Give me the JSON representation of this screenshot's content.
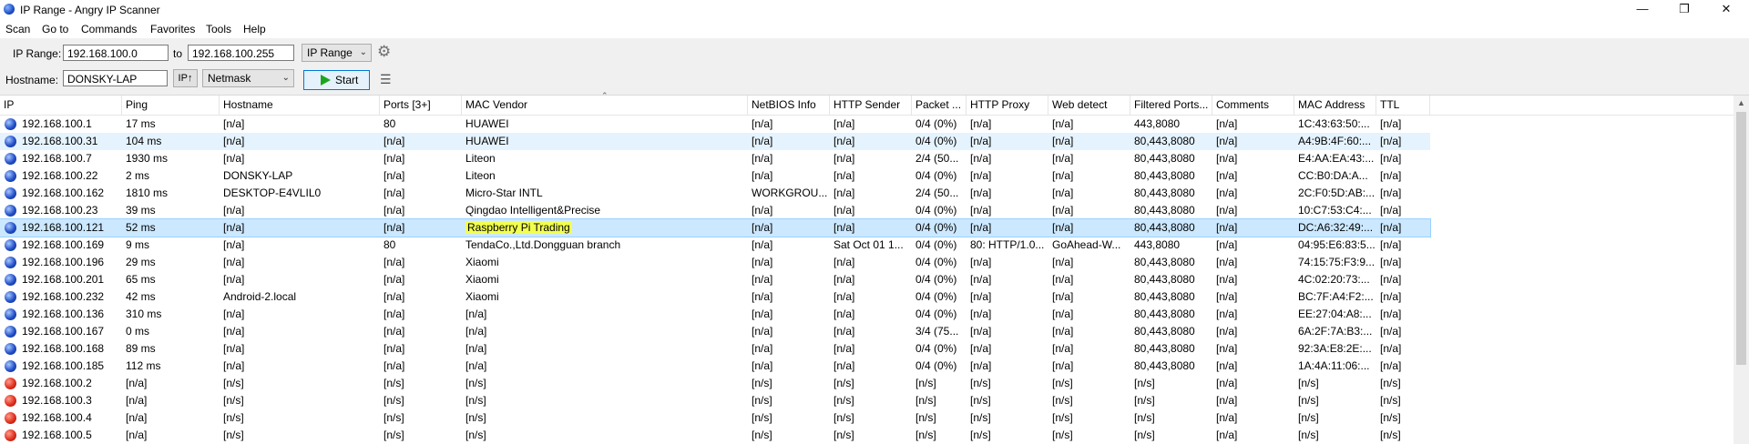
{
  "window": {
    "title": "IP Range - Angry IP Scanner",
    "controls": {
      "minimize": "—",
      "maximize": "❐",
      "close": "✕"
    }
  },
  "menu": [
    "Scan",
    "Go to",
    "Commands",
    "Favorites",
    "Tools",
    "Help"
  ],
  "toolbar": {
    "ip_range_label": "IP Range:",
    "range_start": "192.168.100.0",
    "to_label": "to",
    "range_end": "192.168.100.255",
    "feeder_select": "IP Range",
    "hostname_label": "Hostname:",
    "hostname_value": "DONSKY-LAP",
    "ip_up_button": "IP↑",
    "netmask_select": "Netmask",
    "start_button": "Start",
    "icons": [
      "gear-icon",
      "columns-list-icon",
      "start-play-icon"
    ]
  },
  "colors": {
    "accent": "#0078d7",
    "alive": "#2350c9",
    "dead": "#e0301e",
    "highlight_marker": "#f2ff4f",
    "selected_row": "#cce8ff"
  },
  "table": {
    "columns": [
      "IP",
      "Ping",
      "Hostname",
      "Ports [3+]",
      "MAC Vendor",
      "NetBIOS Info",
      "HTTP Sender",
      "Packet ...",
      "HTTP Proxy",
      "Web detect",
      "Filtered Ports...",
      "Comments",
      "MAC Address",
      "TTL"
    ],
    "rows": [
      {
        "status": "alive",
        "cells": [
          "192.168.100.1",
          "17 ms",
          "[n/a]",
          "80",
          "HUAWEI",
          "[n/a]",
          "[n/a]",
          "0/4 (0%)",
          "[n/a]",
          "[n/a]",
          "443,8080",
          "[n/a]",
          "1C:43:63:50:...",
          "[n/a]"
        ]
      },
      {
        "status": "alive",
        "cells": [
          "192.168.100.31",
          "104 ms",
          "[n/a]",
          "[n/a]",
          "HUAWEI",
          "[n/a]",
          "[n/a]",
          "0/4 (0%)",
          "[n/a]",
          "[n/a]",
          "80,443,8080",
          "[n/a]",
          "A4:9B:4F:60:...",
          "[n/a]"
        ]
      },
      {
        "status": "alive",
        "cells": [
          "192.168.100.7",
          "1930 ms",
          "[n/a]",
          "[n/a]",
          "Liteon",
          "[n/a]",
          "[n/a]",
          "2/4 (50...",
          "[n/a]",
          "[n/a]",
          "80,443,8080",
          "[n/a]",
          "E4:AA:EA:43:...",
          "[n/a]"
        ]
      },
      {
        "status": "alive",
        "cells": [
          "192.168.100.22",
          "2 ms",
          "DONSKY-LAP",
          "[n/a]",
          "Liteon",
          "[n/a]",
          "[n/a]",
          "0/4 (0%)",
          "[n/a]",
          "[n/a]",
          "80,443,8080",
          "[n/a]",
          "CC:B0:DA:A...",
          "[n/a]"
        ]
      },
      {
        "status": "alive",
        "cells": [
          "192.168.100.162",
          "1810 ms",
          "DESKTOP-E4VLIL0",
          "[n/a]",
          "Micro-Star INTL",
          "WORKGROU...",
          "[n/a]",
          "2/4 (50...",
          "[n/a]",
          "[n/a]",
          "80,443,8080",
          "[n/a]",
          "2C:F0:5D:AB:...",
          "[n/a]"
        ]
      },
      {
        "status": "alive",
        "cells": [
          "192.168.100.23",
          "39 ms",
          "[n/a]",
          "[n/a]",
          "Qingdao Intelligent&Precise",
          "[n/a]",
          "[n/a]",
          "0/4 (0%)",
          "[n/a]",
          "[n/a]",
          "80,443,8080",
          "[n/a]",
          "10:C7:53:C4:...",
          "[n/a]"
        ]
      },
      {
        "status": "alive",
        "selected": true,
        "cells": [
          "192.168.100.121",
          "52 ms",
          "[n/a]",
          "[n/a]",
          "Raspberry Pi Trading",
          "[n/a]",
          "[n/a]",
          "0/4 (0%)",
          "[n/a]",
          "[n/a]",
          "80,443,8080",
          "[n/a]",
          "DC:A6:32:49:...",
          "[n/a]"
        ]
      },
      {
        "status": "alive",
        "cells": [
          "192.168.100.169",
          "9 ms",
          "[n/a]",
          "80",
          "TendaCo.,Ltd.Dongguan branch",
          "[n/a]",
          "Sat Oct 01 1...",
          "0/4 (0%)",
          "80: HTTP/1.0...",
          "GoAhead-W...",
          "443,8080",
          "[n/a]",
          "04:95:E6:83:5...",
          "[n/a]"
        ]
      },
      {
        "status": "alive",
        "cells": [
          "192.168.100.196",
          "29 ms",
          "[n/a]",
          "[n/a]",
          "Xiaomi",
          "[n/a]",
          "[n/a]",
          "0/4 (0%)",
          "[n/a]",
          "[n/a]",
          "80,443,8080",
          "[n/a]",
          "74:15:75:F3:9...",
          "[n/a]"
        ]
      },
      {
        "status": "alive",
        "cells": [
          "192.168.100.201",
          "65 ms",
          "[n/a]",
          "[n/a]",
          "Xiaomi",
          "[n/a]",
          "[n/a]",
          "0/4 (0%)",
          "[n/a]",
          "[n/a]",
          "80,443,8080",
          "[n/a]",
          "4C:02:20:73:...",
          "[n/a]"
        ]
      },
      {
        "status": "alive",
        "cells": [
          "192.168.100.232",
          "42 ms",
          "Android-2.local",
          "[n/a]",
          "Xiaomi",
          "[n/a]",
          "[n/a]",
          "0/4 (0%)",
          "[n/a]",
          "[n/a]",
          "80,443,8080",
          "[n/a]",
          "BC:7F:A4:F2:...",
          "[n/a]"
        ]
      },
      {
        "status": "alive",
        "cells": [
          "192.168.100.136",
          "310 ms",
          "[n/a]",
          "[n/a]",
          "[n/a]",
          "[n/a]",
          "[n/a]",
          "0/4 (0%)",
          "[n/a]",
          "[n/a]",
          "80,443,8080",
          "[n/a]",
          "EE:27:04:A8:...",
          "[n/a]"
        ]
      },
      {
        "status": "alive",
        "cells": [
          "192.168.100.167",
          "0 ms",
          "[n/a]",
          "[n/a]",
          "[n/a]",
          "[n/a]",
          "[n/a]",
          "3/4 (75...",
          "[n/a]",
          "[n/a]",
          "80,443,8080",
          "[n/a]",
          "6A:2F:7A:B3:...",
          "[n/a]"
        ]
      },
      {
        "status": "alive",
        "cells": [
          "192.168.100.168",
          "89 ms",
          "[n/a]",
          "[n/a]",
          "[n/a]",
          "[n/a]",
          "[n/a]",
          "0/4 (0%)",
          "[n/a]",
          "[n/a]",
          "80,443,8080",
          "[n/a]",
          "92:3A:E8:2E:...",
          "[n/a]"
        ]
      },
      {
        "status": "alive",
        "cells": [
          "192.168.100.185",
          "112 ms",
          "[n/a]",
          "[n/a]",
          "[n/a]",
          "[n/a]",
          "[n/a]",
          "0/4 (0%)",
          "[n/a]",
          "[n/a]",
          "80,443,8080",
          "[n/a]",
          "1A:4A:11:06:...",
          "[n/a]"
        ]
      },
      {
        "status": "dead",
        "cells": [
          "192.168.100.2",
          "[n/a]",
          "[n/s]",
          "[n/s]",
          "[n/s]",
          "[n/s]",
          "[n/s]",
          "[n/s]",
          "[n/s]",
          "[n/s]",
          "[n/s]",
          "[n/a]",
          "[n/s]",
          "[n/s]"
        ]
      },
      {
        "status": "dead",
        "cells": [
          "192.168.100.3",
          "[n/a]",
          "[n/s]",
          "[n/s]",
          "[n/s]",
          "[n/s]",
          "[n/s]",
          "[n/s]",
          "[n/s]",
          "[n/s]",
          "[n/s]",
          "[n/a]",
          "[n/s]",
          "[n/s]"
        ]
      },
      {
        "status": "dead",
        "cells": [
          "192.168.100.4",
          "[n/a]",
          "[n/s]",
          "[n/s]",
          "[n/s]",
          "[n/s]",
          "[n/s]",
          "[n/s]",
          "[n/s]",
          "[n/s]",
          "[n/s]",
          "[n/a]",
          "[n/s]",
          "[n/s]"
        ]
      },
      {
        "status": "dead",
        "cells": [
          "192.168.100.5",
          "[n/a]",
          "[n/s]",
          "[n/s]",
          "[n/s]",
          "[n/s]",
          "[n/s]",
          "[n/s]",
          "[n/s]",
          "[n/s]",
          "[n/s]",
          "[n/a]",
          "[n/s]",
          "[n/s]"
        ]
      }
    ]
  }
}
